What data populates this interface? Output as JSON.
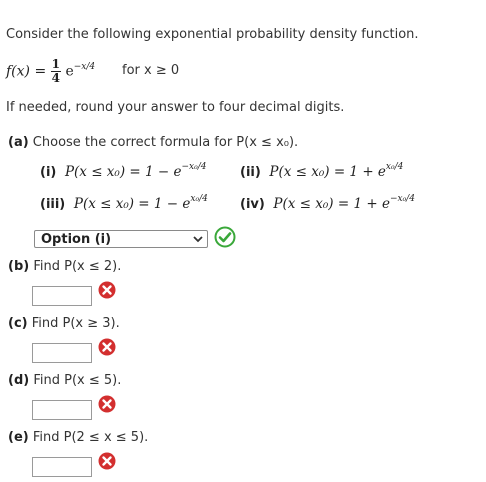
{
  "intro": "Consider the following exponential probability density function.",
  "pdf": {
    "lhs": "f(x) =",
    "frac_num": "1",
    "frac_den": "4",
    "base": "e",
    "exponent": "−x/4",
    "condition": "for x ≥ 0"
  },
  "rounding_note": "If needed, round your answer to four decimal digits.",
  "part_a": {
    "label": "(a)",
    "prompt": "Choose the correct formula for P(x ≤ x₀).",
    "options": [
      {
        "tag": "(i)",
        "lhs": "P(x ≤ x₀) = 1 − e",
        "exp": "−x₀/4"
      },
      {
        "tag": "(ii)",
        "lhs": "P(x ≤ x₀) = 1 + e",
        "exp": "x₀/4"
      },
      {
        "tag": "(iii)",
        "lhs": "P(x ≤ x₀) = 1 − e",
        "exp": "x₀/4"
      },
      {
        "tag": "(iv)",
        "lhs": "P(x ≤ x₀) = 1 + e",
        "exp": "−x₀/4"
      }
    ],
    "selected": "Option (i)"
  },
  "parts": [
    {
      "label": "(b)",
      "prompt": "Find P(x ≤ 2).",
      "value": ""
    },
    {
      "label": "(c)",
      "prompt": "Find P(x ≥ 3).",
      "value": ""
    },
    {
      "label": "(d)",
      "prompt": "Find P(x ≤ 5).",
      "value": ""
    },
    {
      "label": "(e)",
      "prompt": "Find P(2 ≤ x ≤ 5).",
      "value": ""
    }
  ],
  "colors": {
    "correct": "#3aa83a",
    "incorrect": "#d32f2f"
  }
}
